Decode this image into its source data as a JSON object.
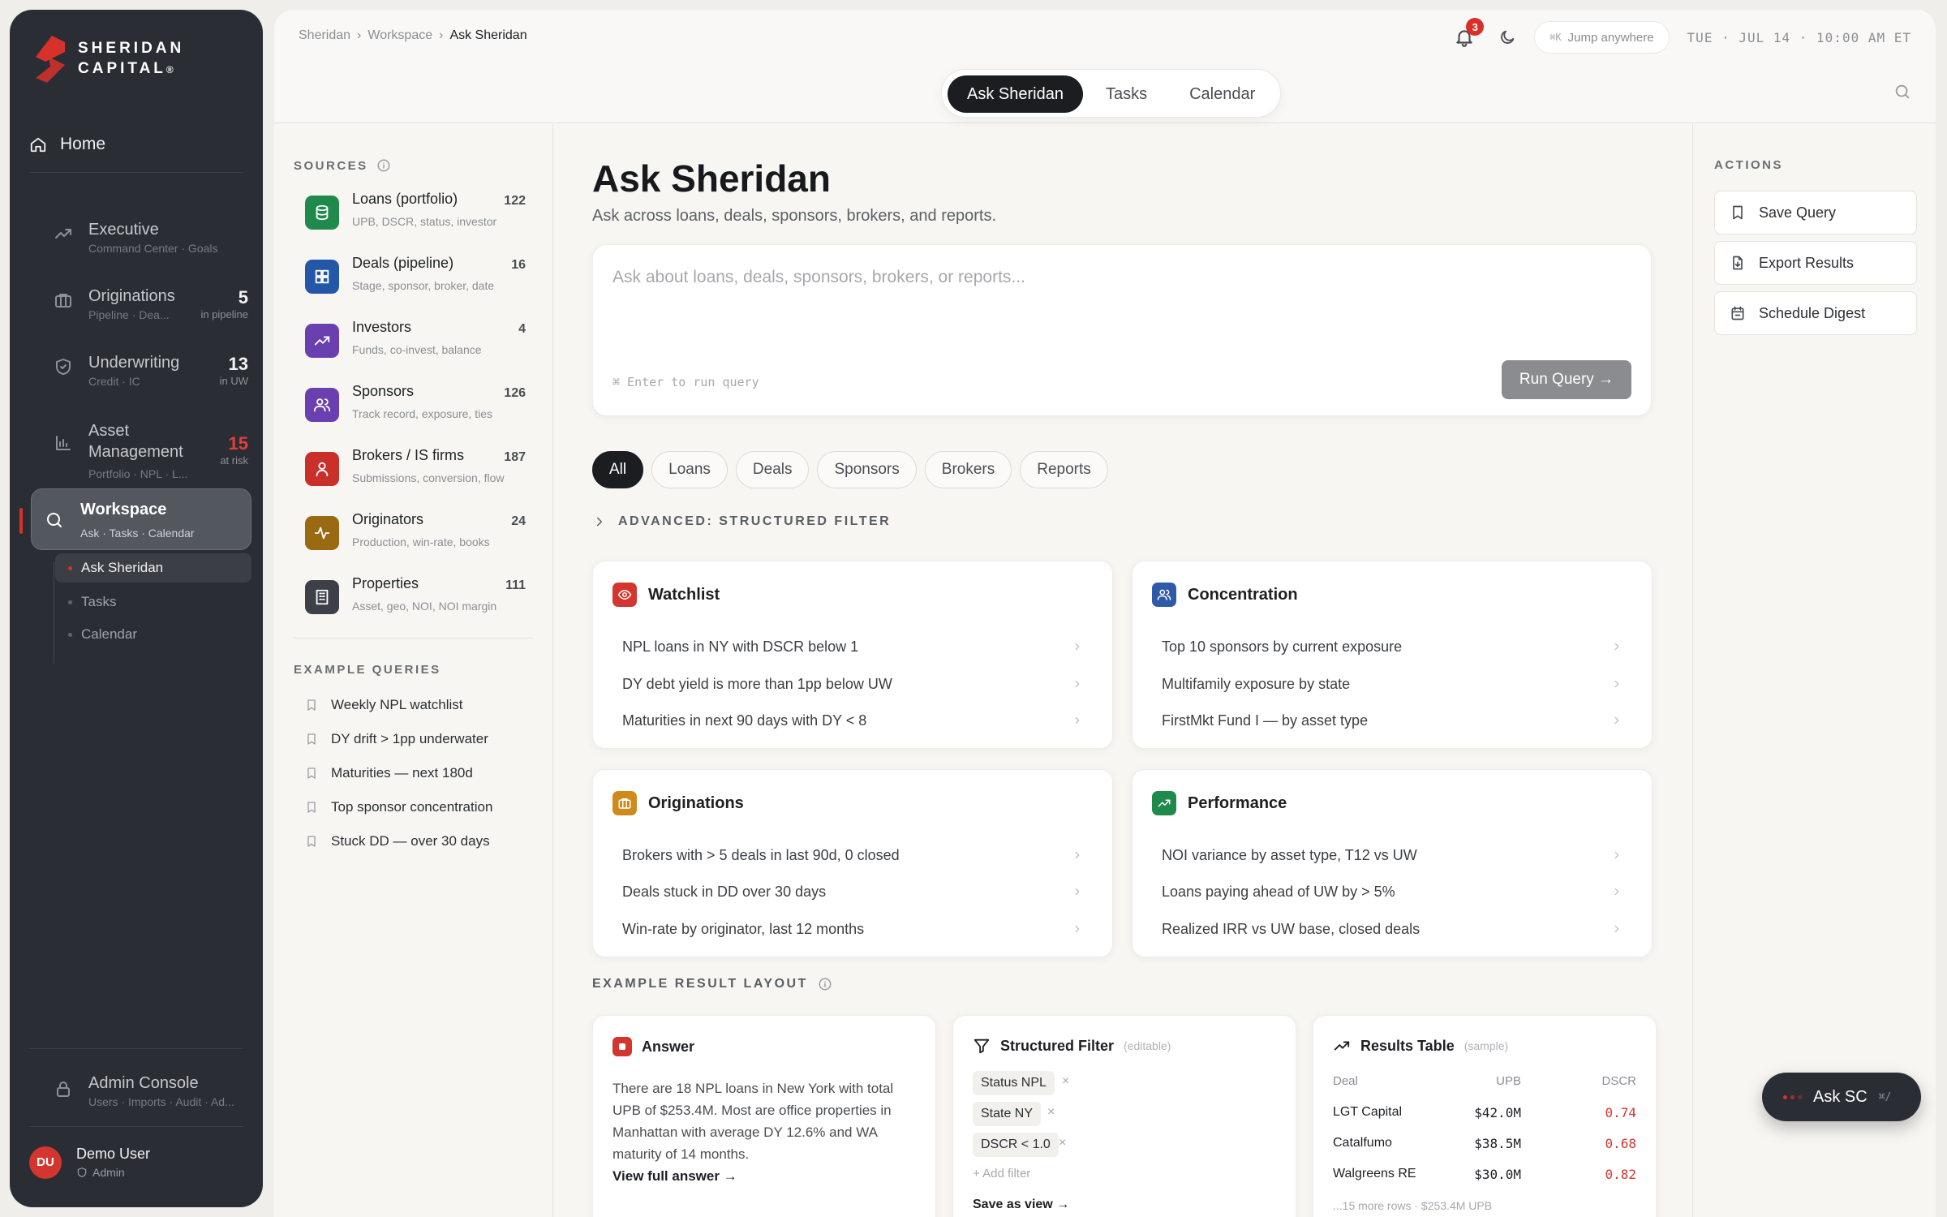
{
  "brand": {
    "line1": "SHERIDAN",
    "line2": "CAPITAL",
    "mark": "®"
  },
  "sidebar": {
    "home": "Home",
    "items": [
      {
        "title": "Executive",
        "sub": "Command Center · Goals",
        "count": "",
        "count_label": ""
      },
      {
        "title": "Originations",
        "sub": "Pipeline · Dea...",
        "count": "5",
        "count_label": "in pipeline"
      },
      {
        "title": "Underwriting",
        "sub": "Credit · IC",
        "count": "13",
        "count_label": "in UW"
      },
      {
        "title": "Asset Management",
        "sub": "Portfolio · NPL · L...",
        "count": "15",
        "count_label": "at risk"
      }
    ],
    "workspace": {
      "title": "Workspace",
      "sub": "Ask · Tasks · Calendar"
    },
    "subitems": [
      "Ask Sheridan",
      "Tasks",
      "Calendar"
    ],
    "admin": {
      "title": "Admin Console",
      "sub": "Users · Imports · Audit · Ad..."
    },
    "user": {
      "initials": "DU",
      "name": "Demo User",
      "role": "Admin"
    }
  },
  "topbar": {
    "breadcrumb": [
      "Sheridan",
      "Workspace",
      "Ask Sheridan"
    ],
    "notifications": "3",
    "jump_label": "Jump anywhere",
    "jump_key": "⌘K",
    "clock": "TUE · JUL 14 · 10:00 AM ET",
    "tabs": [
      "Ask Sheridan",
      "Tasks",
      "Calendar"
    ]
  },
  "sources": {
    "heading": "SOURCES",
    "items": [
      {
        "name": "Loans (portfolio)",
        "desc": "UPB, DSCR, status, investor",
        "count": "122",
        "color": "#1f8a4c",
        "icon": "database-icon"
      },
      {
        "name": "Deals (pipeline)",
        "desc": "Stage, sponsor, broker, date",
        "count": "16",
        "color": "#2457a8",
        "icon": "grid-icon"
      },
      {
        "name": "Investors",
        "desc": "Funds, co-invest, balance",
        "count": "4",
        "color": "#6a3fb0",
        "icon": "trend-icon"
      },
      {
        "name": "Sponsors",
        "desc": "Track record, exposure, ties",
        "count": "126",
        "color": "#6a3fb0",
        "icon": "users-icon"
      },
      {
        "name": "Brokers / IS firms",
        "desc": "Submissions, conversion, flow",
        "count": "187",
        "color": "#c9302a",
        "icon": "user-icon"
      },
      {
        "name": "Originators",
        "desc": "Production, win-rate, books",
        "count": "24",
        "color": "#9a6a12",
        "icon": "pulse-icon"
      },
      {
        "name": "Properties",
        "desc": "Asset, geo, NOI, NOI margin",
        "count": "111",
        "color": "#3d4048",
        "icon": "building-icon"
      }
    ],
    "examples_heading": "EXAMPLE QUERIES",
    "examples": [
      "Weekly NPL watchlist",
      "DY drift > 1pp underwater",
      "Maturities — next 180d",
      "Top sponsor concentration",
      "Stuck DD — over 30 days"
    ]
  },
  "ask": {
    "title": "Ask Sheridan",
    "subtitle": "Ask across loans, deals, sponsors, brokers, and reports.",
    "placeholder": "Ask about loans, deals, sponsors, brokers, or reports...",
    "hint": "⌘ Enter to run query",
    "run": "Run Query →",
    "chips": [
      "All",
      "Loans",
      "Deals",
      "Sponsors",
      "Brokers",
      "Reports"
    ],
    "advanced": "ADVANCED: STRUCTURED FILTER"
  },
  "cards": [
    {
      "title": "Watchlist",
      "color": "#d2362f",
      "icon": "eye-icon",
      "queries": [
        "NPL loans in NY with DSCR below 1",
        "DY debt yield is more than 1pp below UW",
        "Maturities in next 90 days with DY < 8"
      ]
    },
    {
      "title": "Concentration",
      "color": "#2e5aa8",
      "icon": "users-icon",
      "queries": [
        "Top 10 sponsors by current exposure",
        "Multifamily exposure by state",
        "FirstMkt Fund I — by asset type"
      ]
    },
    {
      "title": "Originations",
      "color": "#cf8a1c",
      "icon": "briefcase-icon",
      "queries": [
        "Brokers with > 5 deals in last 90d, 0 closed",
        "Deals stuck in DD over 30 days",
        "Win-rate by originator, last 12 months"
      ]
    },
    {
      "title": "Performance",
      "color": "#1f8a4c",
      "icon": "trend-icon",
      "queries": [
        "NOI variance by asset type, T12 vs UW",
        "Loans paying ahead of UW by > 5%",
        "Realized IRR vs UW base, closed deals"
      ]
    }
  ],
  "result_layout": {
    "heading": "EXAMPLE RESULT LAYOUT",
    "answer": {
      "title": "Answer",
      "text": "There are 18 NPL loans in New York with total UPB of $253.4M. Most are office properties in Manhattan with average DY 12.6% and WA maturity of 14 months.",
      "link": "View full answer →"
    },
    "filter": {
      "title": "Structured Filter",
      "tag": "(editable)",
      "chips": [
        "Status NPL",
        "State NY",
        "DSCR < 1.0"
      ],
      "remove": "×",
      "add": "+ Add filter",
      "save": "Save as view →"
    },
    "table": {
      "title": "Results Table",
      "tag": "(sample)",
      "headers": [
        "Deal",
        "UPB",
        "DSCR"
      ],
      "rows": [
        [
          "LGT Capital",
          "$42.0M",
          "0.74"
        ],
        [
          "Catalfumo",
          "$38.5M",
          "0.68"
        ],
        [
          "Walgreens RE",
          "$30.0M",
          "0.82"
        ]
      ],
      "more": "...15 more rows · $253.4M UPB"
    }
  },
  "actions": {
    "heading": "ACTIONS",
    "items": [
      "Save Query",
      "Export Results",
      "Schedule Digest"
    ]
  },
  "fab": {
    "label": "Ask SC",
    "key": "⌘/"
  },
  "colors": {
    "accent_red": "#d8312b",
    "sidebar_bg": "#2a2d33",
    "dscr_red": "#d2362f"
  }
}
